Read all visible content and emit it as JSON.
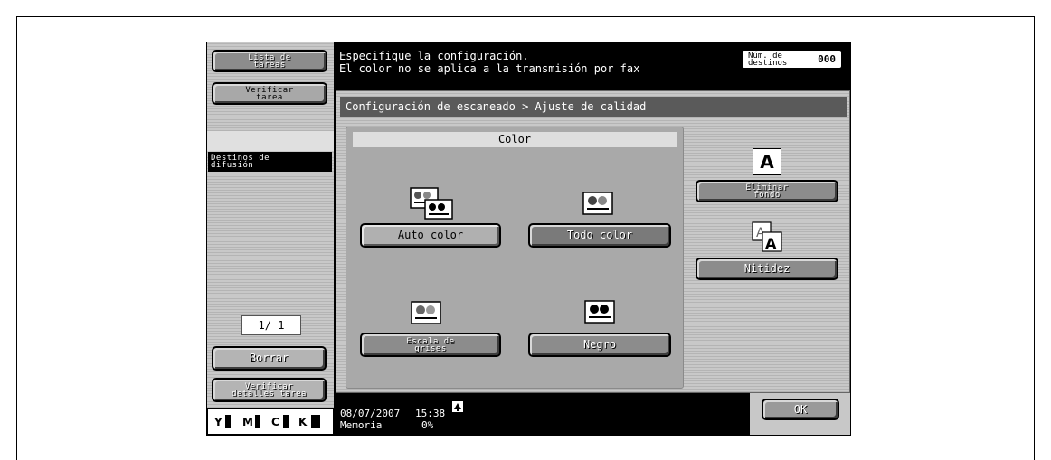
{
  "sidebar": {
    "job_list_label": "Lista de\ntareas",
    "check_job_label": "Verificar\ntarea",
    "broadcast_label": "Destinos de\ndifusión",
    "page_counter": "1/  1",
    "delete_label": "Borrar",
    "check_details_label": "Verificar\ndetalles tarea",
    "toners": [
      "Y",
      "M",
      "C",
      "K"
    ]
  },
  "header": {
    "line1": "Especifique la configuración.",
    "line2": "El color no se aplica a la transmisión por fax",
    "destinations_label": "Núm. de\ndestinos",
    "destinations_count": "000"
  },
  "breadcrumb": "Configuración de escaneado > Ajuste de calidad",
  "color": {
    "title": "Color",
    "options": [
      "Auto color",
      "Todo color",
      "Escala de\ngrises",
      "Negro"
    ],
    "selected": "Todo color"
  },
  "right": {
    "remove_bg_label": "Eliminar\nfondo",
    "sharpness_label": "Nitidez"
  },
  "status": {
    "date": "08/07/2007",
    "time": "15:38",
    "memory_label": "Memoria",
    "memory_value": "0%"
  },
  "ok_label": "OK",
  "colors": {
    "panel_bg": "#c8c8c8",
    "selected_btn": "#7a7a7a",
    "button": "#a8a8a8"
  }
}
